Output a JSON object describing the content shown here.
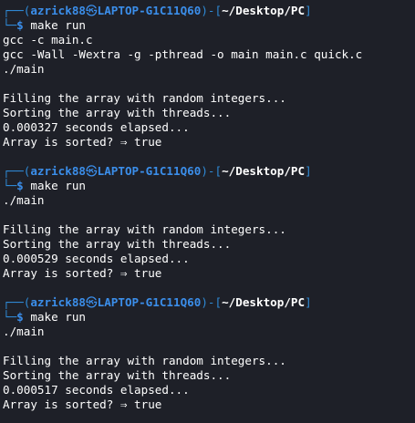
{
  "prompt": {
    "user": "azrick88",
    "separator_icon": "skull-icon",
    "separator_glyph": "㉿",
    "host": "LAPTOP-G1C11Q60",
    "cwd": "~/Desktop/PC",
    "top_prefix": "┌──(",
    "mid": ")-[",
    "top_suffix": "]",
    "bottom_prefix": "└─",
    "dollar": "$"
  },
  "blocks": [
    {
      "command": "make run",
      "build_output": [
        "gcc -c main.c",
        "gcc -Wall -Wextra -g -pthread -o main main.c quick.c",
        "./main"
      ],
      "program_output": [
        "Filling the array with random integers...",
        "Sorting the array with threads...",
        "0.000327 seconds elapsed...",
        "Array is sorted? ⇒ true"
      ]
    },
    {
      "command": "make run",
      "build_output": [
        "./main"
      ],
      "program_output": [
        "Filling the array with random integers...",
        "Sorting the array with threads...",
        "0.000529 seconds elapsed...",
        "Array is sorted? ⇒ true"
      ]
    },
    {
      "command": "make run",
      "build_output": [
        "./main"
      ],
      "program_output": [
        "Filling the array with random integers...",
        "Sorting the array with threads...",
        "0.000517 seconds elapsed...",
        "Array is sorted? ⇒ true"
      ]
    }
  ],
  "colors": {
    "background": "#1e2028",
    "prompt_blue": "#3b8eea",
    "text": "#ffffff"
  }
}
